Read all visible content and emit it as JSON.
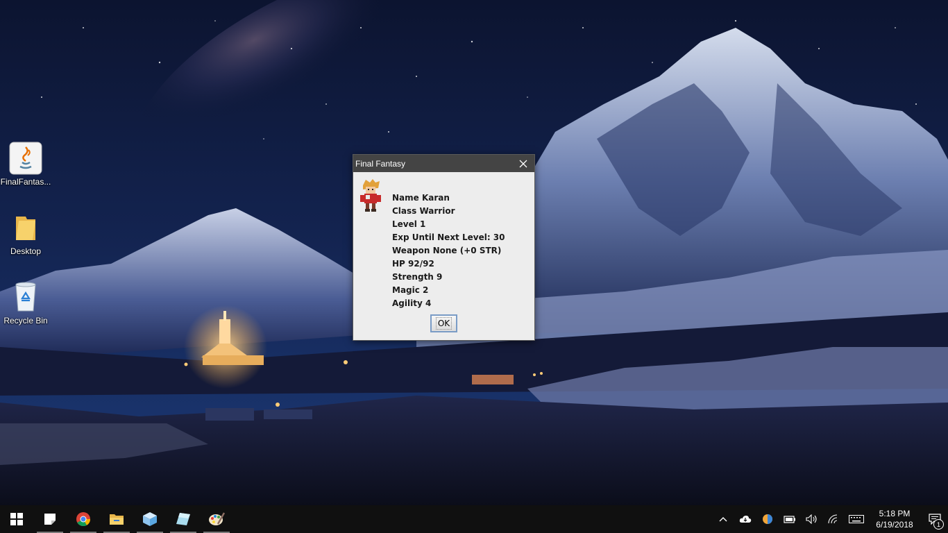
{
  "desktop": {
    "icons": [
      {
        "label": "FinalFantas...",
        "icon": "java-icon"
      },
      {
        "label": "Desktop",
        "icon": "folder-icon"
      },
      {
        "label": "Recycle Bin",
        "icon": "recycle-bin-icon"
      }
    ]
  },
  "dialog": {
    "title": "Final Fantasy",
    "portrait_icon": "warrior-sprite-icon",
    "stats": [
      "Name Karan",
      "Class Warrior",
      "Level 1",
      "Exp Until Next Level: 30",
      "Weapon None (+0 STR)",
      "HP 92/92",
      "Strength 9",
      "Magic 2",
      "Agility 4"
    ],
    "ok_label": "OK"
  },
  "taskbar": {
    "apps": [
      "start-icon",
      "sticky-notes-icon",
      "chrome-icon",
      "file-explorer-icon",
      "3d-builder-icon",
      "glass-app-icon",
      "paint-icon"
    ],
    "tray": [
      "chevron-up-icon",
      "onedrive-icon",
      "color-app-icon",
      "battery-icon",
      "volume-icon",
      "wifi-icon",
      "keyboard-icon"
    ],
    "time": "5:18 PM",
    "date": "6/19/2018",
    "notification_count": "1"
  },
  "colors": {
    "titlebar": "#444444",
    "dialog_bg": "#ededed",
    "taskbar": "#101010",
    "ok_border": "#7a9cc6"
  }
}
